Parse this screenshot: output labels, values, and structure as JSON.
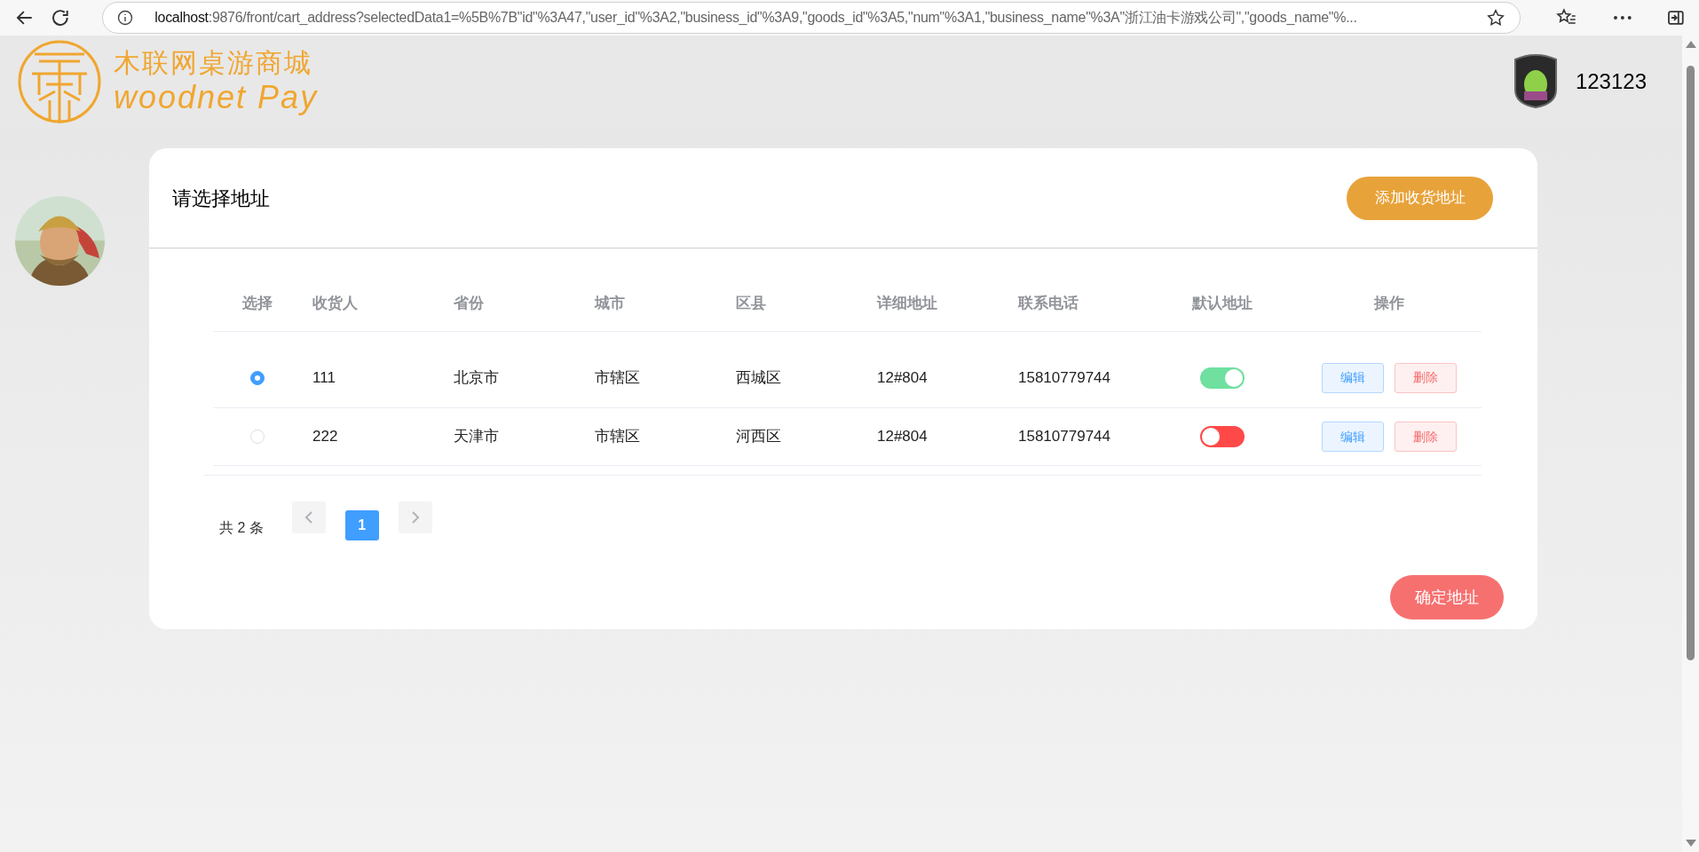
{
  "browser": {
    "url_host": "localhost",
    "url_path": ":9876/front/cart_address?selectedData1=%5B%7B\"id\"%3A47,\"user_id\"%3A2,\"business_id\"%3A9,\"goods_id\"%3A5,\"num\"%3A1,\"business_name\"%3A\"浙江油卡游戏公司\",\"goods_name\"%..."
  },
  "header": {
    "logo_title": "木联网桌游商城",
    "logo_subtitle": "woodnet Pay",
    "username": "123123"
  },
  "card": {
    "title": "请选择地址",
    "add_button": "添加收货地址"
  },
  "table": {
    "columns": [
      "选择",
      "收货人",
      "省份",
      "城市",
      "区县",
      "详细地址",
      "联系电话",
      "默认地址",
      "操作"
    ],
    "rows": [
      {
        "selected": true,
        "receiver": "111",
        "province": "北京市",
        "city": "市辖区",
        "district": "西城区",
        "detail": "12#804",
        "phone": "15810779744",
        "default_on": true,
        "edit_label": "编辑",
        "delete_label": "删除"
      },
      {
        "selected": false,
        "receiver": "222",
        "province": "天津市",
        "city": "市辖区",
        "district": "河西区",
        "detail": "12#804",
        "phone": "15810779744",
        "default_on": false,
        "edit_label": "编辑",
        "delete_label": "删除"
      }
    ]
  },
  "pagination": {
    "total": "共 2 条",
    "pages": [
      {
        "label": "1",
        "selected": true
      }
    ]
  },
  "confirm_button": "确定地址"
}
